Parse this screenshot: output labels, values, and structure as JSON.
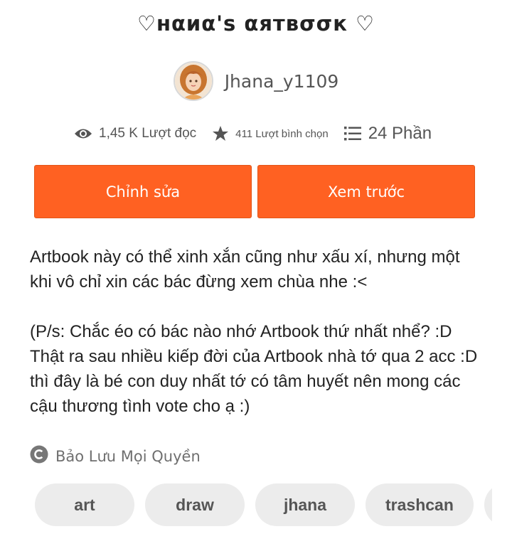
{
  "story": {
    "title": "♡нαиα'ѕ αятвσσк ♡",
    "author": "Jhana_y1109"
  },
  "stats": {
    "reads": "1,45 K Lượt đọc",
    "votes": "411 Lượt bình chọn",
    "parts": "24 Phần"
  },
  "actions": {
    "edit_label": "Chỉnh sửa",
    "preview_label": "Xem trước"
  },
  "description": "Artbook này có thể xinh xắn cũng như xấu xí, nhưng một khi vô chỉ xin các bác đừng xem chùa nhe :<\n\n(P/s: Chắc éo có bác nào nhớ Artbook thứ nhất nhể? :D Thật ra sau nhiều kiếp đời của Artbook nhà tớ qua 2 acc :D thì đây là bé con duy nhất tớ có tâm huyết nên mong các cậu thương tình vote cho ạ :)",
  "copyright": {
    "label": "Bảo Lưu Mọi Quyền",
    "icon": "copyright-icon"
  },
  "tags": [
    "art",
    "draw",
    "jhana",
    "trashcan",
    ""
  ],
  "colors": {
    "accent": "#ff6122",
    "tag_bg": "#ececec",
    "muted_text": "#555555"
  }
}
